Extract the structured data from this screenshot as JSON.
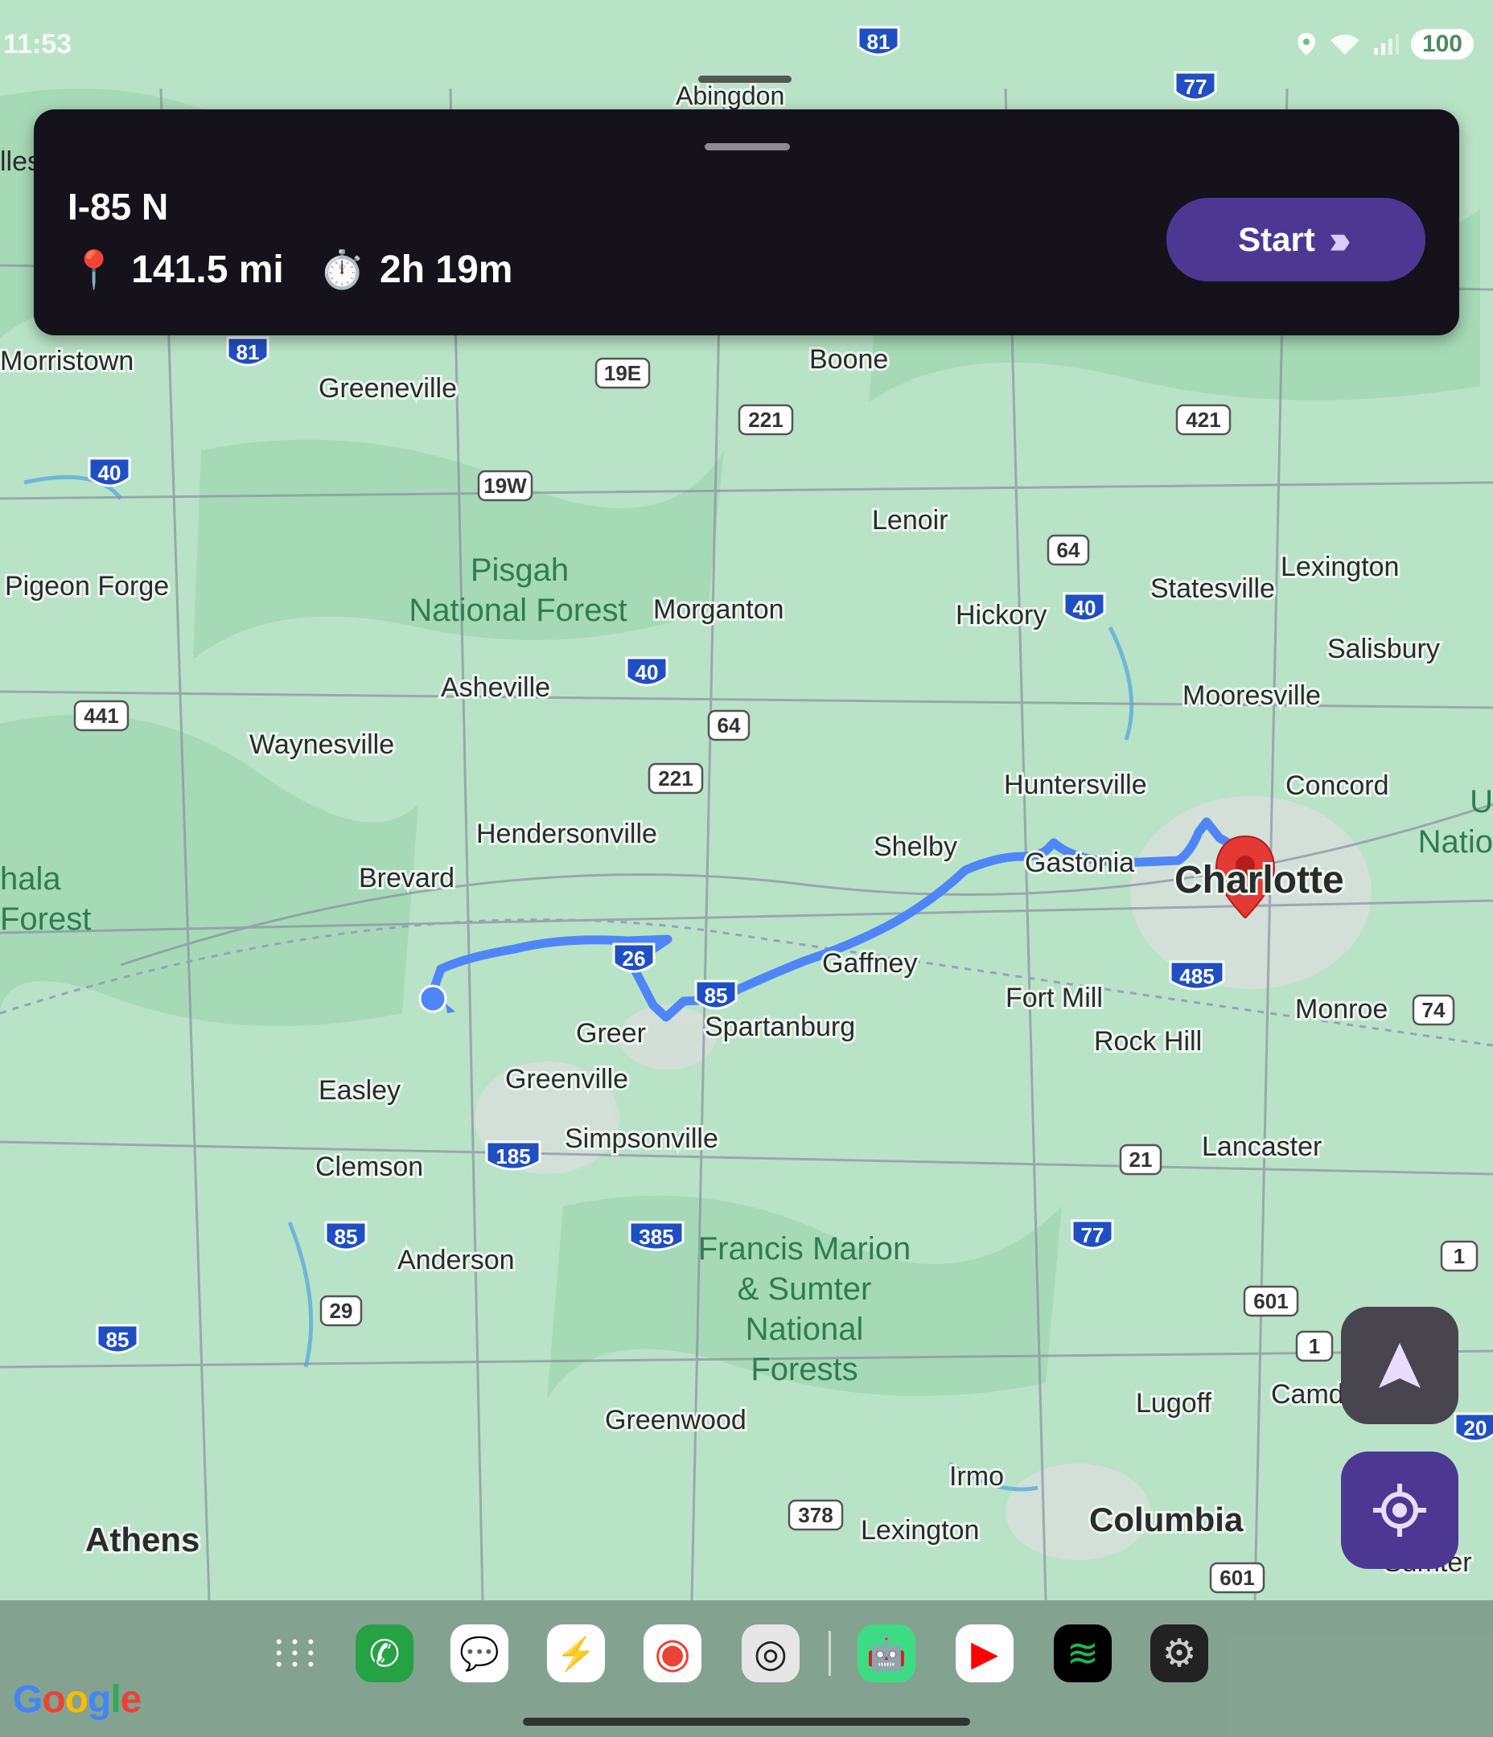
{
  "status_bar": {
    "time": "11:53",
    "battery": "100"
  },
  "route_card": {
    "route_name": "I-85 N",
    "distance": "141.5 mi",
    "duration": "2h 19m",
    "distance_icon": "pin-icon",
    "duration_icon": "stopwatch-icon",
    "start_label": "Start"
  },
  "map": {
    "cities": [
      {
        "name": "Abingdon"
      },
      {
        "name": "Morristown"
      },
      {
        "name": "Greeneville"
      },
      {
        "name": "Boone"
      },
      {
        "name": "Lenoir"
      },
      {
        "name": "Pigeon Forge"
      },
      {
        "name": "Morganton"
      },
      {
        "name": "Hickory"
      },
      {
        "name": "Statesville"
      },
      {
        "name": "Lexington"
      },
      {
        "name": "Salisbury"
      },
      {
        "name": "Mooresville"
      },
      {
        "name": "Asheville"
      },
      {
        "name": "Waynesville"
      },
      {
        "name": "Huntersville"
      },
      {
        "name": "Concord"
      },
      {
        "name": "Hendersonville"
      },
      {
        "name": "Shelby"
      },
      {
        "name": "Gastonia"
      },
      {
        "name": "Brevard"
      },
      {
        "name": "Charlotte"
      },
      {
        "name": "Gaffney"
      },
      {
        "name": "Fort Mill"
      },
      {
        "name": "Monroe"
      },
      {
        "name": "Greer"
      },
      {
        "name": "Spartanburg"
      },
      {
        "name": "Rock Hill"
      },
      {
        "name": "Easley"
      },
      {
        "name": "Greenville"
      },
      {
        "name": "Simpsonville"
      },
      {
        "name": "Clemson"
      },
      {
        "name": "Lancaster"
      },
      {
        "name": "Anderson"
      },
      {
        "name": "Greenwood"
      },
      {
        "name": "Lugoff"
      },
      {
        "name": "Camden"
      },
      {
        "name": "Irmo"
      },
      {
        "name": "Lexington"
      },
      {
        "name": "Columbia"
      },
      {
        "name": "Athens"
      },
      {
        "name": "Sumter"
      }
    ],
    "parks": [
      "Pisgah",
      "National Forest",
      "Francis Marion",
      "& Sumter",
      "National",
      "Forests"
    ],
    "edge_labels": [
      "lles",
      "hala",
      "Forest",
      "U",
      "Natio"
    ],
    "highway_shields": [
      "81",
      "77",
      "81",
      "19E",
      "221",
      "421",
      "40",
      "19W",
      "64",
      "40",
      "40",
      "441",
      "64",
      "221",
      "26",
      "85",
      "485",
      "74",
      "185",
      "85",
      "385",
      "77",
      "29",
      "85",
      "21",
      "601",
      "1",
      "1",
      "378",
      "601",
      "20"
    ]
  },
  "controls": {
    "navigate_icon": "navigation-arrow-icon",
    "location_icon": "my-location-icon"
  },
  "dock": {
    "apps": [
      "app-drawer-icon",
      "phone-icon",
      "messages-icon",
      "messenger-icon",
      "chrome-icon",
      "camera-icon",
      "android-icon",
      "youtube-icon",
      "spotify-icon",
      "settings-icon"
    ]
  },
  "attribution": "Google"
}
